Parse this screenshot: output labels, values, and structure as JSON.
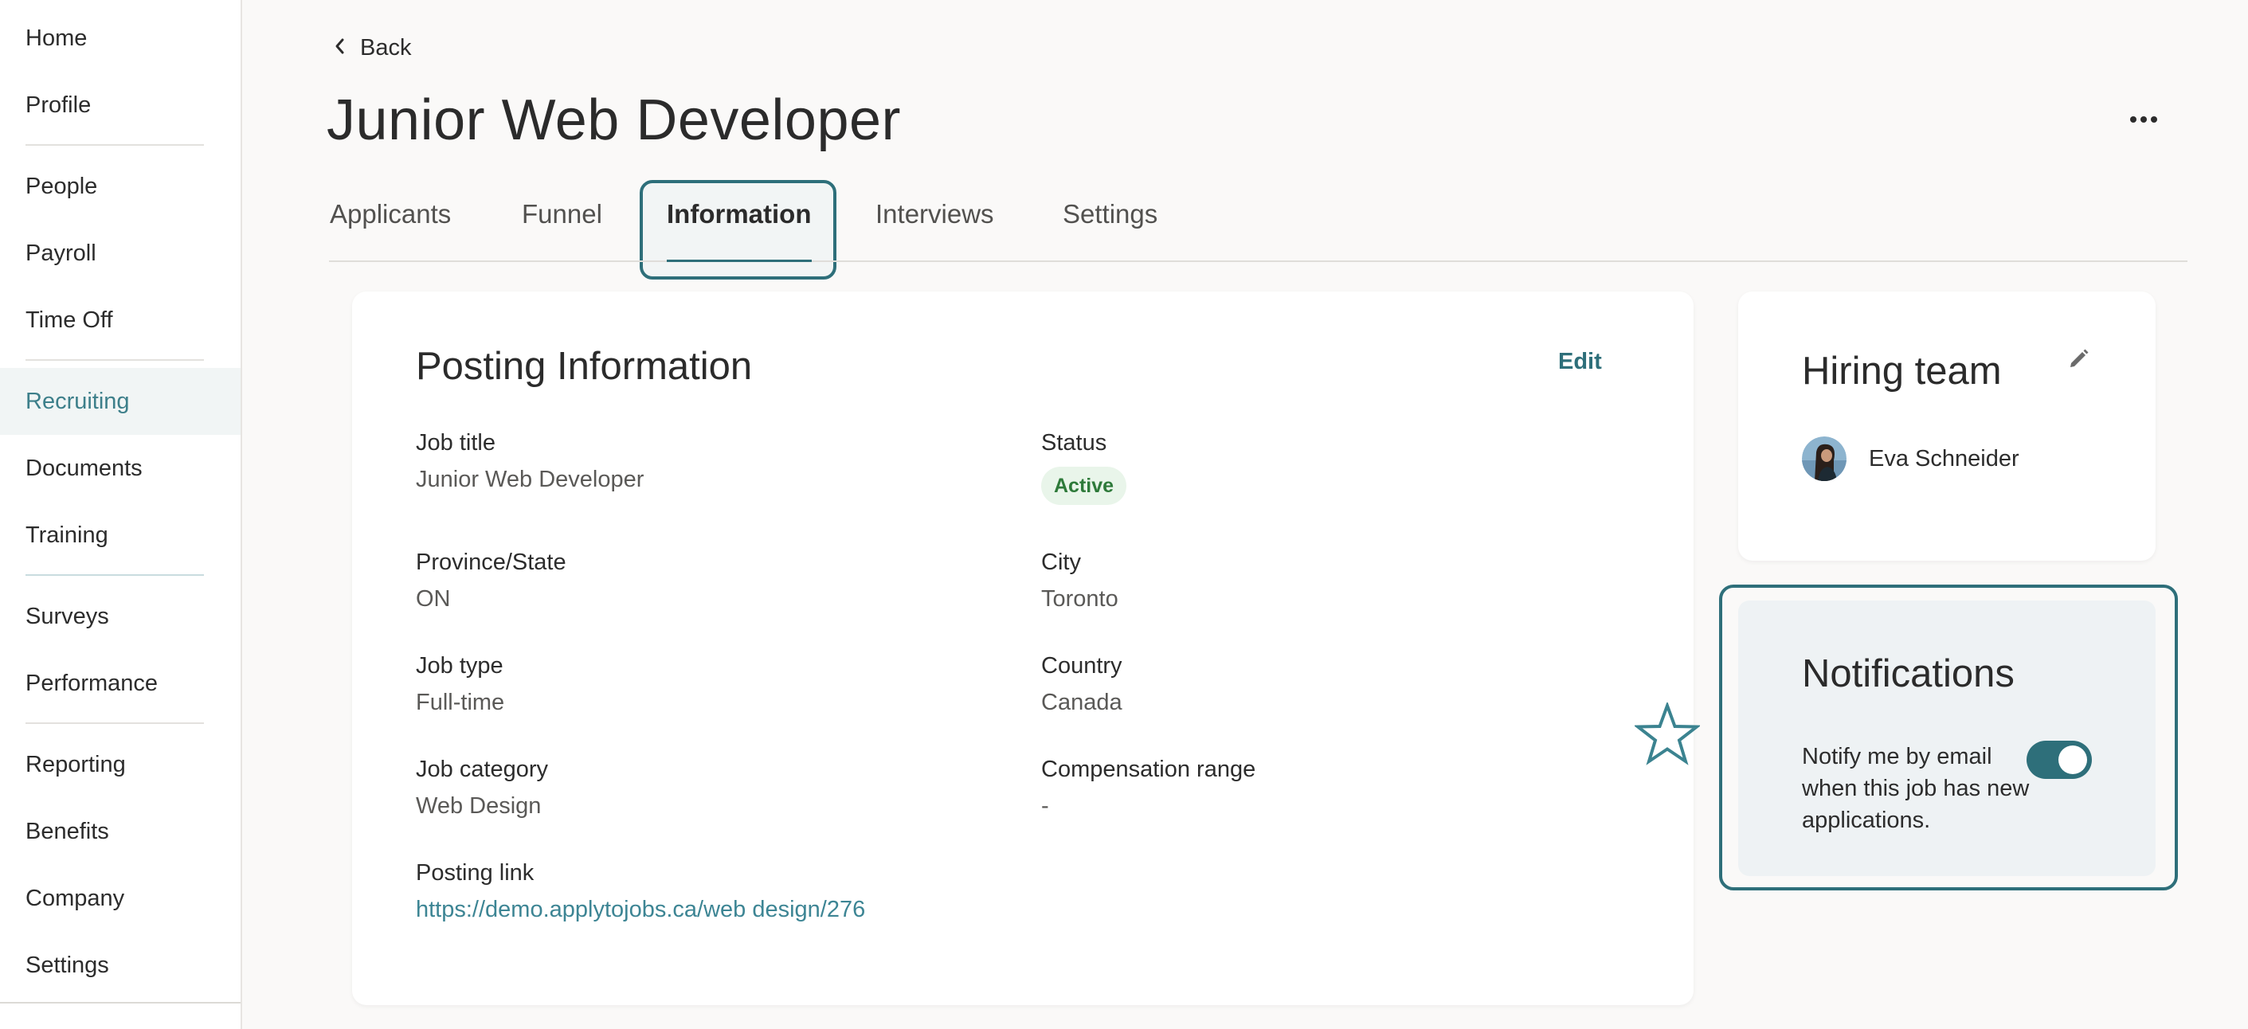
{
  "sidebar": {
    "items": [
      {
        "label": "Home"
      },
      {
        "label": "Profile"
      },
      {
        "label": "People"
      },
      {
        "label": "Payroll"
      },
      {
        "label": "Time Off"
      },
      {
        "label": "Recruiting",
        "active": true
      },
      {
        "label": "Documents"
      },
      {
        "label": "Training"
      },
      {
        "label": "Surveys"
      },
      {
        "label": "Performance"
      },
      {
        "label": "Reporting"
      },
      {
        "label": "Benefits"
      },
      {
        "label": "Company"
      },
      {
        "label": "Settings"
      }
    ]
  },
  "header": {
    "back_label": "Back",
    "title": "Junior Web Developer",
    "more_icon": "more-horizontal-icon"
  },
  "tabs": [
    {
      "label": "Applicants"
    },
    {
      "label": "Funnel"
    },
    {
      "label": "Information",
      "active": true
    },
    {
      "label": "Interviews"
    },
    {
      "label": "Settings"
    }
  ],
  "posting": {
    "title": "Posting Information",
    "edit_label": "Edit",
    "fields": {
      "job_title": {
        "label": "Job title",
        "value": "Junior Web Developer"
      },
      "status": {
        "label": "Status",
        "value": "Active"
      },
      "province": {
        "label": "Province/State",
        "value": "ON"
      },
      "city": {
        "label": "City",
        "value": "Toronto"
      },
      "job_type": {
        "label": "Job type",
        "value": "Full-time"
      },
      "country": {
        "label": "Country",
        "value": "Canada"
      },
      "job_category": {
        "label": "Job category",
        "value": "Web Design"
      },
      "compensation": {
        "label": "Compensation range",
        "value": "-"
      },
      "posting_link": {
        "label": "Posting link",
        "value": "https://demo.applytojobs.ca/web design/276"
      }
    }
  },
  "hiring_team": {
    "title": "Hiring team",
    "members": [
      {
        "name": "Eva Schneider"
      }
    ]
  },
  "notifications": {
    "title": "Notifications",
    "description": "Notify me by email when this job has new applications.",
    "enabled": true
  },
  "colors": {
    "accent": "#2e6f7a",
    "link": "#3d8594",
    "status_active_bg": "#e9f5ea",
    "status_active_text": "#2e7a3a"
  }
}
